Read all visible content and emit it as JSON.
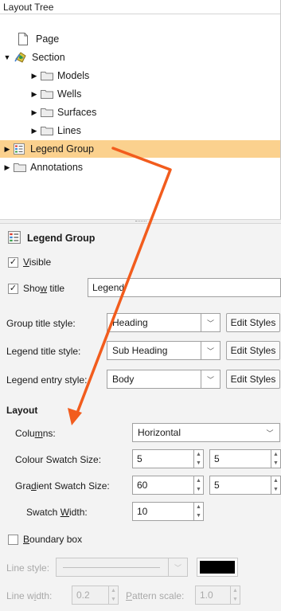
{
  "tree": {
    "header": "Layout Tree",
    "items": [
      {
        "label": "Page"
      },
      {
        "label": "Section"
      },
      {
        "label": "Models"
      },
      {
        "label": "Wells"
      },
      {
        "label": "Surfaces"
      },
      {
        "label": "Lines"
      },
      {
        "label": "Legend Group"
      },
      {
        "label": "Annotations"
      }
    ]
  },
  "props": {
    "title": "Legend Group",
    "visible": {
      "before": "",
      "mnemonic": "V",
      "after": "isible",
      "checked": true
    },
    "show_title": {
      "before": "Sho",
      "mnemonic": "w",
      "after": " title",
      "checked": true,
      "value": "Legend"
    },
    "group_title_style": {
      "label": "Group title style:",
      "value": "Heading",
      "button": "Edit Styles"
    },
    "legend_title_style": {
      "label": "Legend title style:",
      "value": "Sub Heading",
      "button": "Edit Styles"
    },
    "legend_entry_style": {
      "label": "Legend entry style:",
      "value": "Body",
      "button": "Edit Styles"
    },
    "layout_heading": "Layout",
    "columns": {
      "before": "Colu",
      "mnemonic": "m",
      "after": "ns:",
      "value": "Horizontal"
    },
    "colour_swatch": {
      "label": "Colour Swatch Size:",
      "v1": "5",
      "v2": "5"
    },
    "gradient_swatch": {
      "before": "Gra",
      "mnemonic": "d",
      "after": "ient Swatch Size:",
      "v1": "60",
      "v2": "5"
    },
    "swatch_width": {
      "before": "Swatch ",
      "mnemonic": "W",
      "after": "idth:",
      "value": "10"
    },
    "boundary_box": {
      "before": "",
      "mnemonic": "B",
      "after": "oundary box",
      "checked": false
    },
    "line_style": {
      "label": "Line style:",
      "color": "#000000"
    },
    "line_width": {
      "before": "Line w",
      "mnemonic": "i",
      "after": "dth:",
      "value": "0.2"
    },
    "pattern_scale": {
      "before": "",
      "mnemonic": "P",
      "after": "attern scale:",
      "value": "1.0"
    }
  },
  "colors": {
    "selection": "#fbd18e",
    "annotation_arrow": "#f25c1d",
    "folder": "#e8e8e8"
  },
  "icons": [
    "page-icon",
    "section-icon",
    "folder-icon",
    "legend-group-icon",
    "expand-triangle-icon",
    "collapse-triangle-icon",
    "dropdown-chevron-icon",
    "spin-up-icon",
    "spin-down-icon"
  ]
}
